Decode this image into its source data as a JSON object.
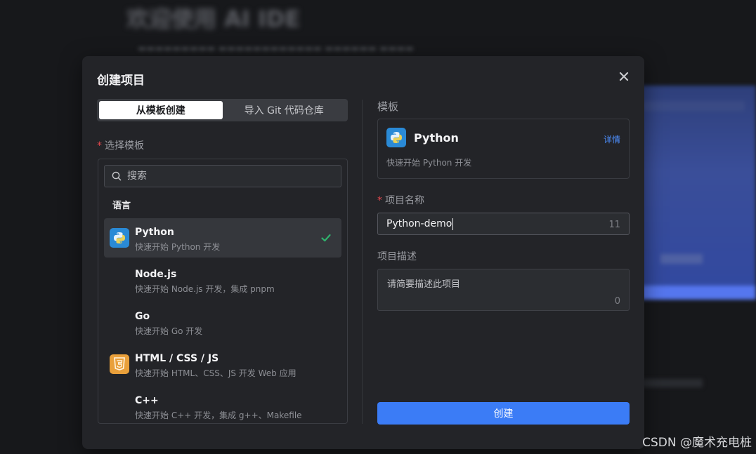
{
  "background": {
    "title": "欢迎使用 AI IDE"
  },
  "modal": {
    "title": "创建项目",
    "close_icon": "close-icon"
  },
  "tabs": [
    {
      "label": "从模板创建",
      "active": true
    },
    {
      "label": "导入 Git 代码仓库",
      "active": false
    }
  ],
  "select_template": {
    "label": "选择模板",
    "required": true,
    "search_placeholder": "搜索",
    "group_label": "语言",
    "items": [
      {
        "name": "Python",
        "desc": "快速开始 Python 开发",
        "icon": "python-icon",
        "selected": true
      },
      {
        "name": "Node.js",
        "desc": "快速开始 Node.js 开发，集成 pnpm",
        "icon": "",
        "selected": false
      },
      {
        "name": "Go",
        "desc": "快速开始 Go 开发",
        "icon": "",
        "selected": false
      },
      {
        "name": "HTML / CSS / JS",
        "desc": "快速开始 HTML、CSS、JS 开发 Web 应用",
        "icon": "html5-icon",
        "selected": false
      },
      {
        "name": "C++",
        "desc": "快速开始 C++ 开发，集成 g++、Makefile",
        "icon": "",
        "selected": false
      }
    ]
  },
  "template_panel": {
    "label": "模板",
    "name": "Python",
    "detail_link": "详情",
    "desc": "快速开始 Python 开发"
  },
  "project_name": {
    "label": "项目名称",
    "required": true,
    "value": "Python-demo",
    "count": "11"
  },
  "project_desc": {
    "label": "项目描述",
    "placeholder": "请简要描述此项目",
    "count": "0"
  },
  "create_button": "创建",
  "watermark": "CSDN @魔术充电桩",
  "colors": {
    "accent": "#3b7cf6",
    "python_icon": "#2a8ad6",
    "html_icon": "#e9a03b",
    "check": "#2fb36d",
    "required": "#e5484d"
  }
}
